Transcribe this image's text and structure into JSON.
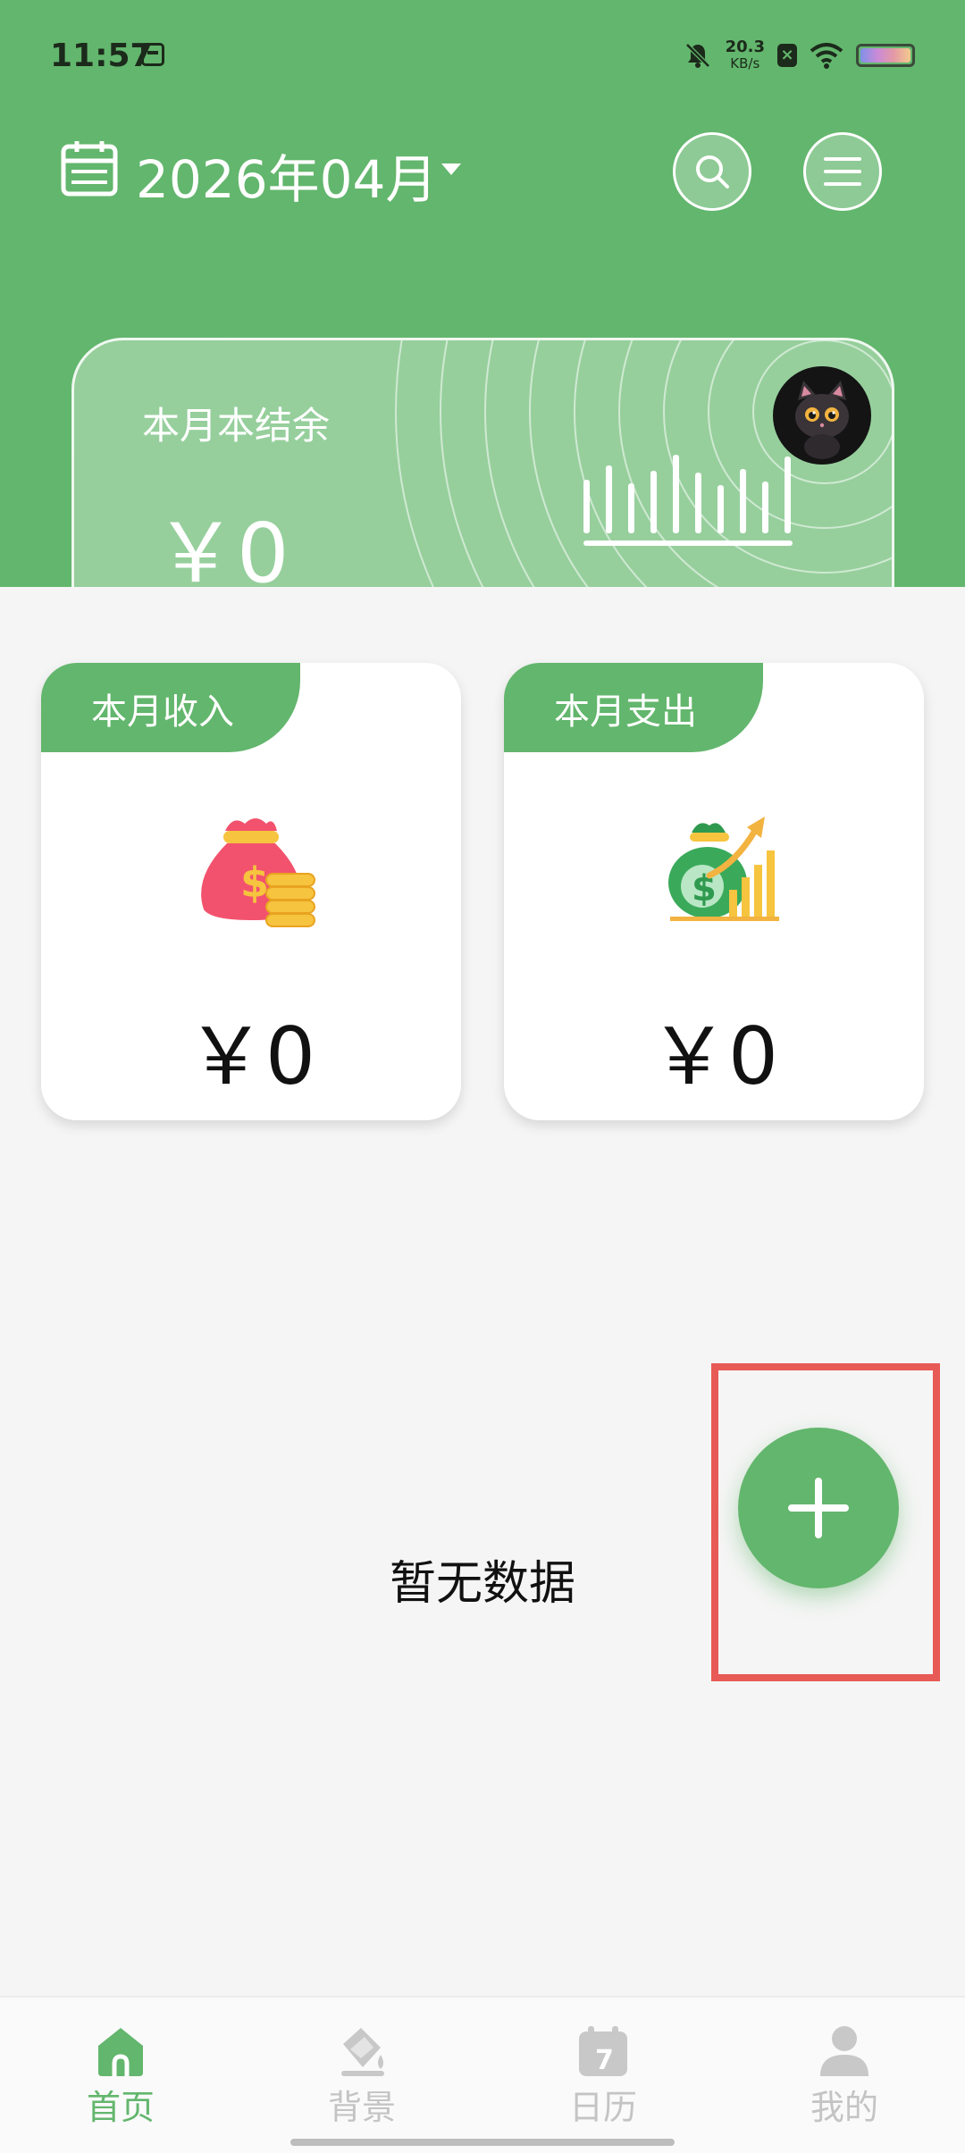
{
  "status_bar": {
    "time": "11:57",
    "net_speed_value": "20.3",
    "net_speed_unit": "KB/s"
  },
  "header": {
    "month_title": "2026年04月"
  },
  "balance_card": {
    "label": "本月本结余",
    "amount": "￥0"
  },
  "income_card": {
    "label": "本月收入",
    "amount": "￥0"
  },
  "expense_card": {
    "label": "本月支出",
    "amount": "￥0"
  },
  "empty_state": {
    "text": "暂无数据"
  },
  "bottom_nav": [
    {
      "label": "首页",
      "icon": "home-icon",
      "active": true
    },
    {
      "label": "背景",
      "icon": "paint-bucket-icon",
      "active": false
    },
    {
      "label": "日历",
      "icon": "calendar-icon",
      "active": false
    },
    {
      "label": "我的",
      "icon": "profile-icon",
      "active": false
    }
  ],
  "colors": {
    "primary": "#63b66d",
    "highlight": "#e85a55",
    "inactive_nav": "#c4c4c4"
  }
}
